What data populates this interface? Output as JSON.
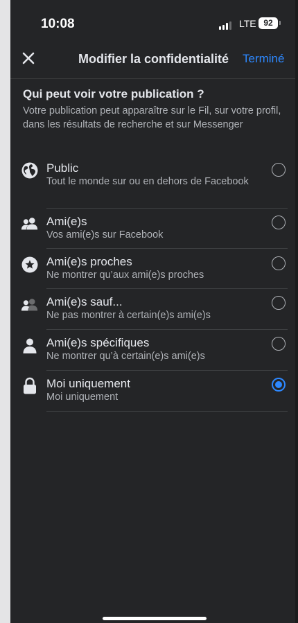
{
  "status": {
    "time": "10:08",
    "network": "LTE",
    "battery": "92"
  },
  "header": {
    "title": "Modifier la confidentialité",
    "done_label": "Terminé"
  },
  "section": {
    "title": "Qui peut voir votre publication ?",
    "description": "Votre publication peut apparaître sur le Fil, sur votre profil, dans les résultats de recherche et sur Messenger"
  },
  "options": [
    {
      "label": "Public",
      "sub": "Tout le monde sur ou en dehors de Facebook",
      "icon": "globe-icon",
      "selected": false
    },
    {
      "label": "Ami(e)s",
      "sub": "Vos ami(e)s sur Facebook",
      "icon": "friends-icon",
      "selected": false
    },
    {
      "label": "Ami(e)s proches",
      "sub": "Ne montrer qu’aux ami(e)s proches",
      "icon": "star-icon",
      "selected": false
    },
    {
      "label": "Ami(e)s sauf...",
      "sub": "Ne pas montrer à certain(e)s ami(e)s",
      "icon": "friends-except-icon",
      "selected": false
    },
    {
      "label": "Ami(e)s spécifiques",
      "sub": "Ne montrer qu’à certain(e)s ami(e)s",
      "icon": "person-icon",
      "selected": false
    },
    {
      "label": "Moi uniquement",
      "sub": "Moi uniquement",
      "icon": "lock-icon",
      "selected": true
    }
  ],
  "colors": {
    "accent": "#2d88ff",
    "background": "#242527",
    "text": "#e4e6eb",
    "secondary_text": "#b0b3b8"
  }
}
